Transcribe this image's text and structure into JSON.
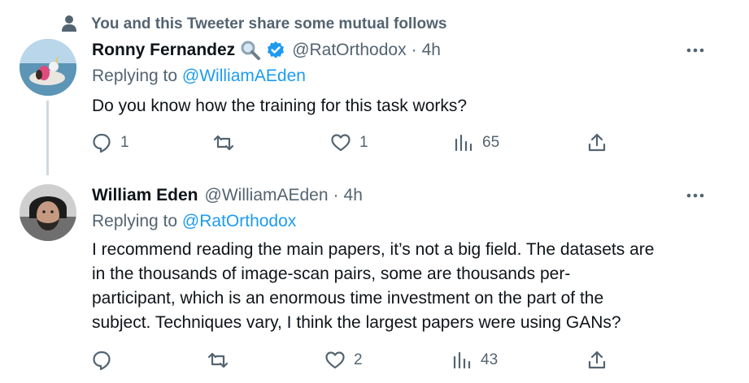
{
  "social_context": {
    "text": "You and this Tweeter share some mutual follows"
  },
  "tweets": [
    {
      "name": "Ronny Fernandez",
      "handle": "@RatOrthodox",
      "separator": "·",
      "time": "4h",
      "verified_badge": "verified-check-icon",
      "emoji": "magnifying-glass-emoji",
      "replying_prefix": "Replying to ",
      "replying_to": "@WilliamAEden",
      "text": "Do you know how the training for this task works?",
      "replies": "1",
      "retweets": "",
      "likes": "1",
      "views": "65"
    },
    {
      "name": "William Eden",
      "handle": "@WilliamAEden",
      "separator": "·",
      "time": "4h",
      "replying_prefix": "Replying to ",
      "replying_to": "@RatOrthodox",
      "text_lines": [
        "I recommend reading the main papers, it’s not a big field. The datasets are",
        "in the thousands of image-scan pairs, some are thousands per-",
        "participant, which is an enormous time investment on the part of the",
        "subject. Techniques vary, I think the largest papers were using GANs?"
      ],
      "replies": "",
      "retweets": "",
      "likes": "2",
      "views": "43"
    }
  ],
  "colors": {
    "text": "#0f1419",
    "secondary": "#536471",
    "link": "#1d9bf0",
    "thread_line": "#cfd9de",
    "verified": "#1d9bf0"
  }
}
